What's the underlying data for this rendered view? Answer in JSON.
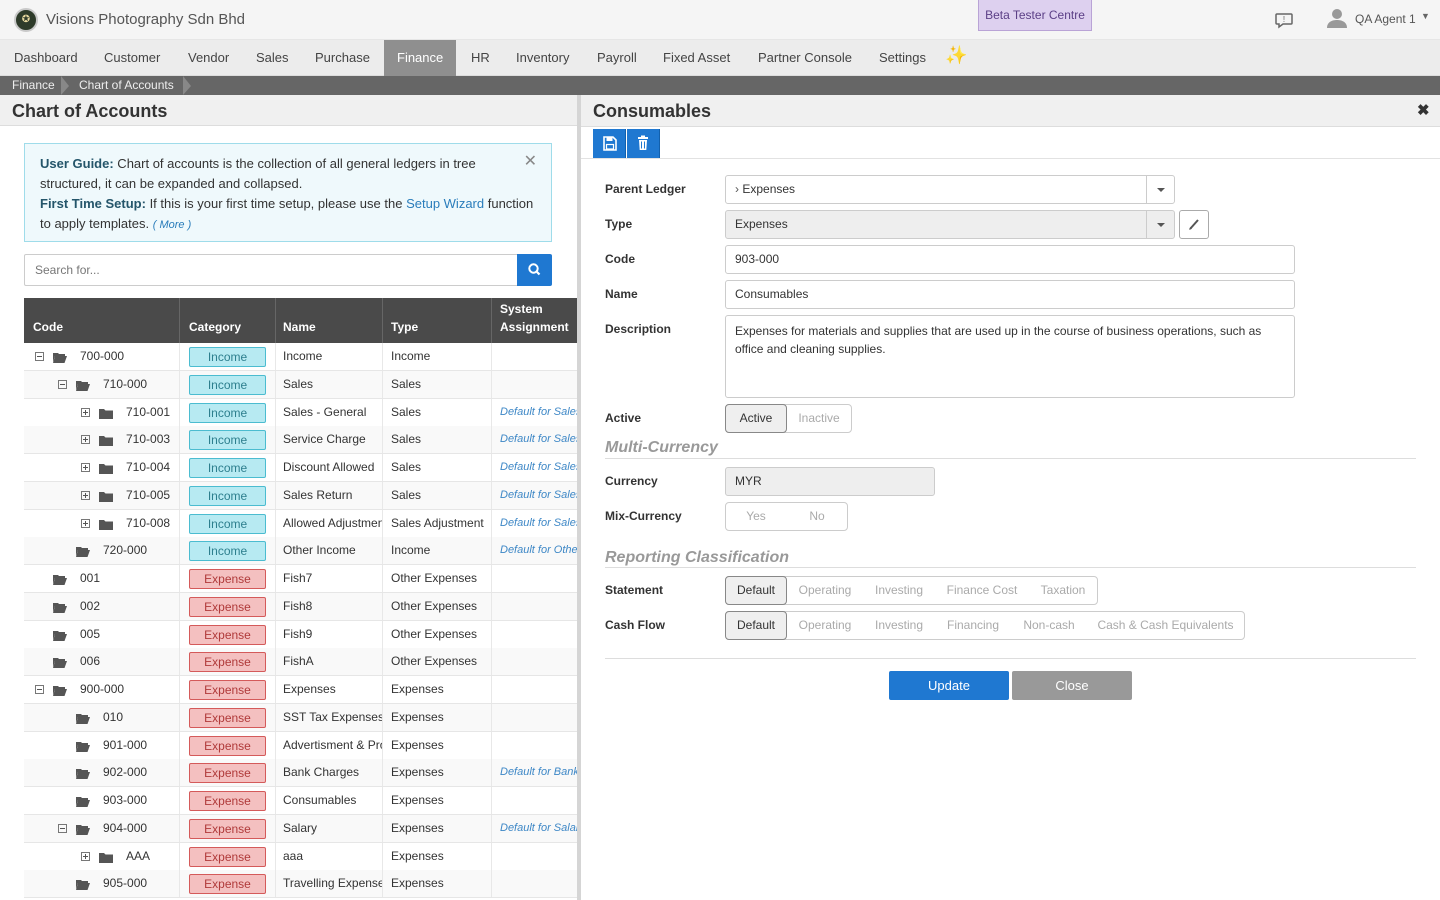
{
  "app": {
    "company": "Visions Photography Sdn Bhd",
    "beta_label": "Beta Tester Centre",
    "user_name": "QA Agent 1"
  },
  "nav": [
    {
      "label": "Dashboard"
    },
    {
      "label": "Customer"
    },
    {
      "label": "Vendor"
    },
    {
      "label": "Sales"
    },
    {
      "label": "Purchase"
    },
    {
      "label": "Finance",
      "active": true
    },
    {
      "label": "HR"
    },
    {
      "label": "Inventory"
    },
    {
      "label": "Payroll"
    },
    {
      "label": "Fixed Asset"
    },
    {
      "label": "Partner Console"
    },
    {
      "label": "Settings"
    }
  ],
  "breadcrumb": [
    "Finance",
    "Chart of Accounts"
  ],
  "left": {
    "title": "Chart of Accounts",
    "guide": {
      "label1": "User Guide:",
      "text1": " Chart of accounts is the collection of all general ledgers in tree structured, it can be expanded and collapsed.",
      "label2": "First Time Setup:",
      "text2a": " If this is your first time setup, please use the ",
      "link": "Setup Wizard",
      "text2b": " function to apply templates. ",
      "more": "( More )"
    },
    "search_placeholder": "Search for...",
    "columns": {
      "code": "Code",
      "category": "Category",
      "name": "Name",
      "type": "Type",
      "sys1": "System",
      "sys2": "Assignment"
    },
    "rows": [
      {
        "level": 0,
        "toggle": "minus",
        "folder": "open",
        "code": "700-000",
        "category": "Income",
        "name": "Income",
        "type": "Income",
        "sys": ""
      },
      {
        "level": 1,
        "toggle": "minus",
        "folder": "open",
        "code": "710-000",
        "category": "Income",
        "name": "Sales",
        "type": "Sales",
        "sys": ""
      },
      {
        "level": 2,
        "toggle": "plus",
        "folder": "closed",
        "code": "710-001",
        "category": "Income",
        "name": "Sales - General",
        "type": "Sales",
        "sys": "Default for Sales"
      },
      {
        "level": 2,
        "toggle": "plus",
        "folder": "closed",
        "code": "710-003",
        "category": "Income",
        "name": "Service Charge",
        "type": "Sales",
        "sys": "Default for Sales"
      },
      {
        "level": 2,
        "toggle": "plus",
        "folder": "closed",
        "code": "710-004",
        "category": "Income",
        "name": "Discount Allowed",
        "type": "Sales",
        "sys": "Default for Sales"
      },
      {
        "level": 2,
        "toggle": "plus",
        "folder": "closed",
        "code": "710-005",
        "category": "Income",
        "name": "Sales Return",
        "type": "Sales",
        "sys": "Default for Sales"
      },
      {
        "level": 2,
        "toggle": "plus",
        "folder": "closed",
        "code": "710-008",
        "category": "Income",
        "name": "Allowed Adjustment",
        "type": "Sales Adjustment",
        "sys": "Default for Sales"
      },
      {
        "level": 1,
        "toggle": "",
        "folder": "open",
        "code": "720-000",
        "category": "Income",
        "name": "Other Income",
        "type": "Income",
        "sys": "Default for Other"
      },
      {
        "level": 0,
        "toggle": "",
        "folder": "open",
        "code": "001",
        "category": "Expense",
        "name": "Fish7",
        "type": "Other Expenses",
        "sys": ""
      },
      {
        "level": 0,
        "toggle": "",
        "folder": "open",
        "code": "002",
        "category": "Expense",
        "name": "Fish8",
        "type": "Other Expenses",
        "sys": ""
      },
      {
        "level": 0,
        "toggle": "",
        "folder": "open",
        "code": "005",
        "category": "Expense",
        "name": "Fish9",
        "type": "Other Expenses",
        "sys": ""
      },
      {
        "level": 0,
        "toggle": "",
        "folder": "open",
        "code": "006",
        "category": "Expense",
        "name": "FishA",
        "type": "Other Expenses",
        "sys": ""
      },
      {
        "level": 0,
        "toggle": "minus",
        "folder": "open",
        "code": "900-000",
        "category": "Expense",
        "name": "Expenses",
        "type": "Expenses",
        "sys": ""
      },
      {
        "level": 1,
        "toggle": "",
        "folder": "open",
        "code": "010",
        "category": "Expense",
        "name": "SST Tax Expenses",
        "type": "Expenses",
        "sys": ""
      },
      {
        "level": 1,
        "toggle": "",
        "folder": "open",
        "code": "901-000",
        "category": "Expense",
        "name": "Advertisment & Promotion",
        "type": "Expenses",
        "sys": ""
      },
      {
        "level": 1,
        "toggle": "",
        "folder": "open",
        "code": "902-000",
        "category": "Expense",
        "name": "Bank Charges",
        "type": "Expenses",
        "sys": "Default for Bank"
      },
      {
        "level": 1,
        "toggle": "",
        "folder": "open",
        "code": "903-000",
        "category": "Expense",
        "name": "Consumables",
        "type": "Expenses",
        "sys": ""
      },
      {
        "level": 1,
        "toggle": "minus",
        "folder": "open",
        "code": "904-000",
        "category": "Expense",
        "name": "Salary",
        "type": "Expenses",
        "sys": "Default for Salary"
      },
      {
        "level": 2,
        "toggle": "plus",
        "folder": "closed",
        "code": "AAA",
        "category": "Expense",
        "name": "aaa",
        "type": "Expenses",
        "sys": ""
      },
      {
        "level": 1,
        "toggle": "",
        "folder": "open",
        "code": "905-000",
        "category": "Expense",
        "name": "Travelling Expenses",
        "type": "Expenses",
        "sys": ""
      }
    ]
  },
  "detail": {
    "title": "Consumables",
    "labels": {
      "parent": "Parent Ledger",
      "type": "Type",
      "code": "Code",
      "name": "Name",
      "description": "Description",
      "active": "Active",
      "currency": "Currency",
      "mix": "Mix-Currency",
      "statement": "Statement",
      "cashflow": "Cash Flow"
    },
    "parent_ledger": "Expenses",
    "type": "Expenses",
    "code": "903-000",
    "name": "Consumables",
    "description": "Expenses for materials and supplies that are used up in the course of business operations, such as office and cleaning supplies.",
    "active_options": [
      "Active",
      "Inactive"
    ],
    "active_selected": "Active",
    "multi_currency_title": "Multi-Currency",
    "currency": "MYR",
    "mix_options": [
      "Yes",
      "No"
    ],
    "reporting_title": "Reporting Classification",
    "statement_options": [
      "Default",
      "Operating",
      "Investing",
      "Finance Cost",
      "Taxation"
    ],
    "cashflow_options": [
      "Default",
      "Operating",
      "Investing",
      "Financing",
      "Non-cash",
      "Cash & Cash Equivalents"
    ],
    "update_label": "Update",
    "close_label": "Close"
  }
}
